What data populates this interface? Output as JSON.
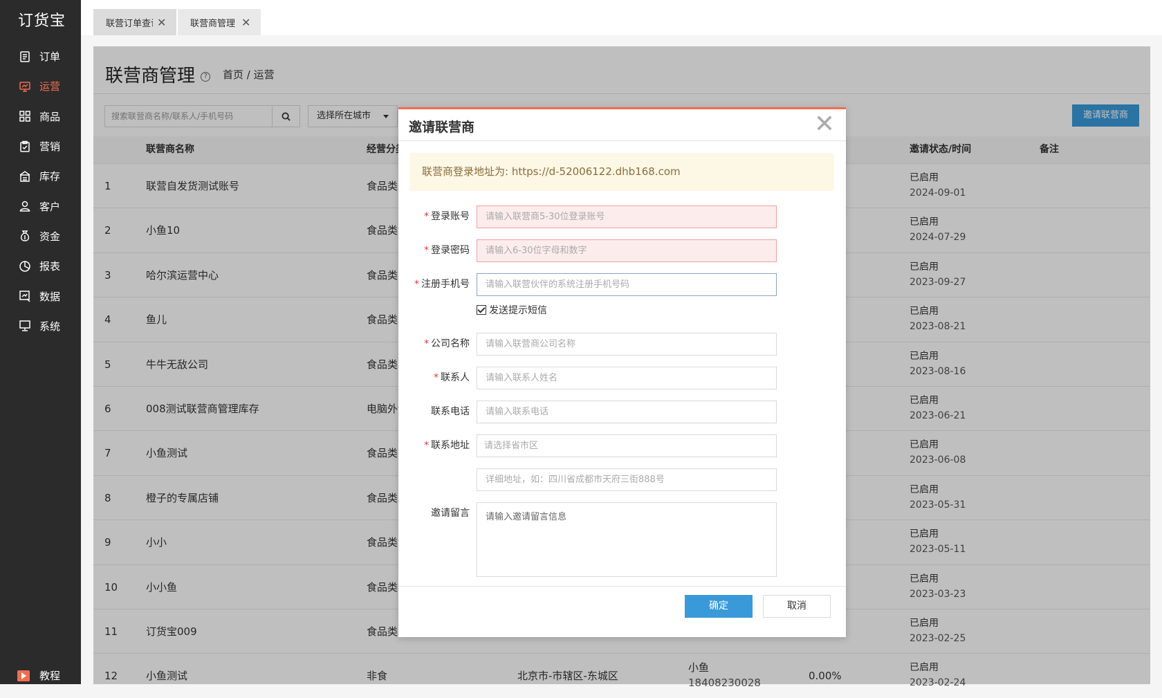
{
  "app": {
    "logo": "订货宝"
  },
  "sidebar": {
    "items": [
      {
        "label": "订单",
        "icon": "order-icon"
      },
      {
        "label": "运营",
        "icon": "operation-icon"
      },
      {
        "label": "商品",
        "icon": "product-icon"
      },
      {
        "label": "营销",
        "icon": "marketing-icon"
      },
      {
        "label": "库存",
        "icon": "warehouse-icon"
      },
      {
        "label": "客户",
        "icon": "customer-icon"
      },
      {
        "label": "资金",
        "icon": "money-bag-icon"
      },
      {
        "label": "报表",
        "icon": "pie-chart-icon"
      },
      {
        "label": "数据",
        "icon": "data-analysis-icon"
      },
      {
        "label": "系统",
        "icon": "monitor-icon"
      }
    ],
    "active": "运营",
    "tutorial": "教程"
  },
  "tabs": [
    {
      "label": "联营订单查询",
      "close": "✕"
    },
    {
      "label": "联营商管理",
      "close": "✕"
    }
  ],
  "page": {
    "title": "联营商管理",
    "breadcrumb": "首页 / 运营",
    "search_placeholder": "搜索联营商名称/联系人/手机号码",
    "city_select": "选择所在城市",
    "invite_button": "邀请联营商"
  },
  "table": {
    "headers": {
      "name": "联营商名称",
      "category": "经营分类",
      "status": "邀请状态/时间",
      "remark": "备注"
    },
    "rows": [
      {
        "no": "1",
        "name": "联营自发货测试账号",
        "category": "食品类",
        "status": "已启用",
        "date": "2024-09-01"
      },
      {
        "no": "2",
        "name": "小鱼10",
        "category": "食品类",
        "status": "已启用",
        "date": "2024-07-29"
      },
      {
        "no": "3",
        "name": "哈尔滨运营中心",
        "category": "食品类...",
        "status": "已启用",
        "date": "2023-09-27"
      },
      {
        "no": "4",
        "name": "鱼儿",
        "category": "食品类...",
        "status": "已启用",
        "date": "2023-08-21"
      },
      {
        "no": "5",
        "name": "牛牛无敌公司",
        "category": "食品类",
        "status": "已启用",
        "date": "2023-08-16"
      },
      {
        "no": "6",
        "name": "008测试联营商管理库存",
        "category": "电脑外设",
        "status": "已启用",
        "date": "2023-06-21"
      },
      {
        "no": "7",
        "name": "小鱼测试",
        "category": "食品类",
        "status": "已启用",
        "date": "2023-06-08"
      },
      {
        "no": "8",
        "name": "橙子的专属店铺",
        "category": "食品类...",
        "status": "已启用",
        "date": "2023-05-31"
      },
      {
        "no": "9",
        "name": "小小",
        "category": "食品类",
        "status": "已启用",
        "date": "2023-05-11"
      },
      {
        "no": "10",
        "name": "小小鱼",
        "category": "食品类",
        "status": "已启用",
        "date": "2023-03-23"
      },
      {
        "no": "11",
        "name": "订货宝009",
        "category": "食品类...",
        "status": "已启用",
        "date": "2023-02-25"
      },
      {
        "no": "12",
        "name": "小鱼测试",
        "category": "非食",
        "city": "北京市-市辖区-东城区",
        "contact": "小鱼",
        "phone": "18408230028",
        "rate": "0.00%",
        "status": "已启用",
        "date": "2023-02-24"
      }
    ]
  },
  "modal": {
    "title": "邀请联营商",
    "close": "✕",
    "notice": "联营商登录地址为: https://d-52006122.dhb168.com",
    "fields": {
      "account": {
        "label": "登录账号",
        "placeholder": "请输入联营商5-30位登录账号"
      },
      "password": {
        "label": "登录密码",
        "placeholder": "请输入6-30位字母和数字"
      },
      "phone": {
        "label": "注册手机号",
        "placeholder": "请输入联营伙伴的系统注册手机号码"
      },
      "sms": {
        "label": "发送提示短信",
        "checked": true
      },
      "company": {
        "label": "公司名称",
        "placeholder": "请输入联营商公司名称"
      },
      "contact": {
        "label": "联系人",
        "placeholder": "请输入联系人姓名"
      },
      "tel": {
        "label": "联系电话",
        "placeholder": "请输入联系电话"
      },
      "address": {
        "label": "联系地址",
        "placeholder": "请选择省市区",
        "detail_placeholder": "详细地址，如：四川省成都市天府三街888号"
      },
      "message": {
        "label": "邀请留言",
        "placeholder": "请输入邀请留言信息"
      }
    },
    "confirm": "确定",
    "cancel": "取消"
  },
  "colors": {
    "accent": "#f26d52",
    "primary": "#3a9ad9",
    "sidebar": "#2b2b2b"
  }
}
